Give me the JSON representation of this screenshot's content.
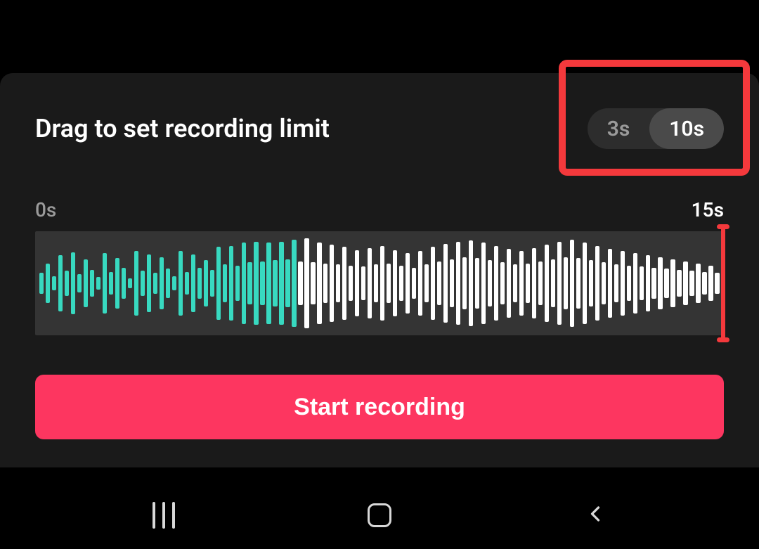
{
  "panel": {
    "title": "Drag to set recording limit",
    "toggle_options": [
      {
        "label": "3s",
        "selected": false
      },
      {
        "label": "10s",
        "selected": true
      }
    ],
    "time_start_label": "0s",
    "time_end_label": "15s",
    "start_button_label": "Start recording"
  },
  "colors": {
    "accent_teal": "#38d9c0",
    "accent_red": "#fd3660",
    "highlight": "#f4393c"
  },
  "waveform": {
    "teal_count": 41,
    "total_count": 108,
    "heights": [
      20,
      38,
      14,
      54,
      24,
      60,
      18,
      46,
      26,
      12,
      58,
      22,
      48,
      30,
      10,
      62,
      24,
      56,
      20,
      50,
      28,
      14,
      62,
      22,
      56,
      30,
      44,
      26,
      70,
      36,
      72,
      34,
      78,
      40,
      80,
      42,
      78,
      44,
      80,
      46,
      84,
      42,
      86,
      40,
      78,
      38,
      74,
      36,
      70,
      34,
      64,
      32,
      68,
      36,
      72,
      38,
      64,
      34,
      58,
      30,
      62,
      36,
      70,
      42,
      76,
      46,
      80,
      50,
      82,
      48,
      78,
      44,
      72,
      40,
      66,
      36,
      62,
      38,
      68,
      42,
      74,
      46,
      80,
      50,
      84,
      48,
      78,
      44,
      72,
      40,
      66,
      36,
      62,
      34,
      58,
      32,
      54,
      30,
      50,
      28,
      46,
      26,
      42,
      24,
      38,
      22,
      34,
      20
    ]
  }
}
